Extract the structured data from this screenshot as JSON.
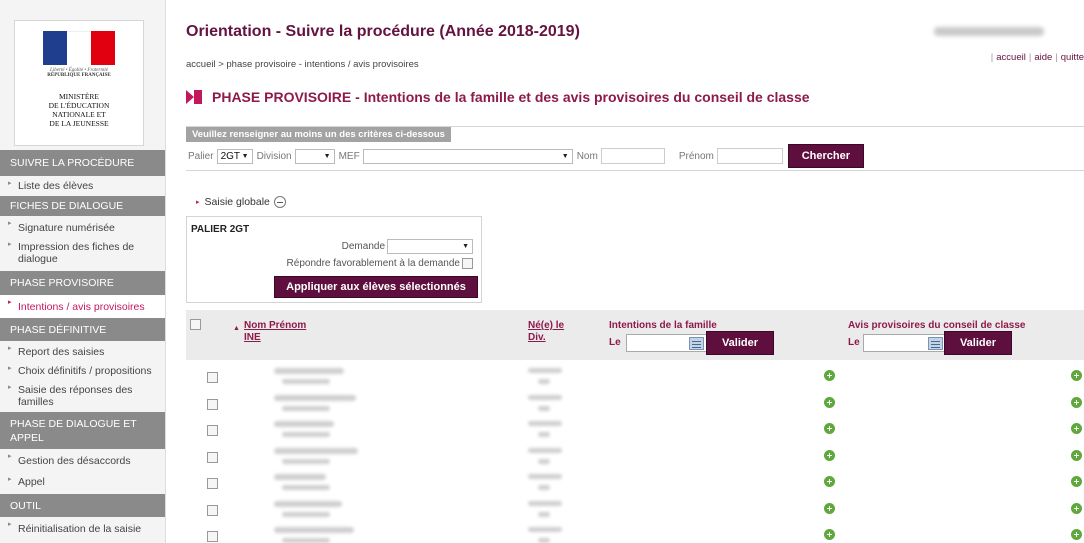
{
  "logo": {
    "motto": "Liberté • Égalité • Fraternité",
    "republique": "RÉPUBLIQUE FRANÇAISE",
    "ministry": "MINISTÈRE\nDE L'ÉDUCATION\nNATIONALE ET\nDE LA JEUNESSE"
  },
  "sidebar": {
    "sections": [
      {
        "title": "SUIVRE LA PROCÉDURE",
        "items": [
          "Liste des élèves"
        ]
      },
      {
        "title": "FICHES DE DIALOGUE",
        "items": [
          "Signature numérisée",
          "Impression des fiches de dialogue"
        ]
      },
      {
        "title": "PHASE PROVISOIRE",
        "items": [
          "Intentions / avis provisoires"
        ]
      },
      {
        "title": "PHASE DÉFINITIVE",
        "items": [
          "Report des saisies",
          "Choix définitifs / propositions",
          "Saisie des réponses des familles"
        ]
      },
      {
        "title": "PHASE DE DIALOGUE ET APPEL",
        "items": [
          "Gestion des désaccords",
          "Appel"
        ]
      },
      {
        "title": "OUTIL",
        "items": [
          "Réinitialisation de la saisie"
        ]
      }
    ],
    "active_item": "Intentions / avis provisoires"
  },
  "header": {
    "title": "Orientation - Suivre la procédure (Année 2018-2019)",
    "breadcrumb": "accueil > phase provisoire - intentions / avis provisoires",
    "links": [
      "accueil",
      "aide",
      "quitte"
    ]
  },
  "phase_title": "PHASE PROVISOIRE - Intentions de la famille et des avis provisoires du conseil de classe",
  "criteria": {
    "legend": "Veuillez renseigner au moins un des critères ci-dessous",
    "palier_label": "Palier",
    "palier_value": "2GT",
    "division_label": "Division",
    "division_value": "",
    "mef_label": "MEF",
    "mef_value": "",
    "nom_label": "Nom",
    "prenom_label": "Prénom",
    "search_button": "Chercher"
  },
  "saisie_globale": {
    "label": "Saisie globale",
    "palier_title": "PALIER 2GT",
    "demande_label": "Demande",
    "demande_value": "",
    "repondre_label": "Répondre favorablement à la demande",
    "apply_button": "Appliquer aux élèves sélectionnés"
  },
  "table": {
    "col_name": "Nom Prénom",
    "col_ine": "INE",
    "col_birth": "Né(e) le",
    "col_div": "Div.",
    "col_intentions": "Intentions de la famille",
    "col_avis": "Avis provisoires du conseil de classe",
    "le_label": "Le",
    "valider_label": "Valider",
    "rows": [
      {
        "checked": false,
        "action_intentions": "add",
        "action_avis": "add"
      },
      {
        "checked": false,
        "action_intentions": "add",
        "action_avis": "add"
      },
      {
        "checked": false,
        "action_intentions": "add",
        "action_avis": "add"
      },
      {
        "checked": false,
        "action_intentions": "add",
        "action_avis": "add"
      },
      {
        "checked": false,
        "action_intentions": "add",
        "action_avis": "add"
      },
      {
        "checked": false,
        "action_intentions": "add",
        "action_avis": "add"
      },
      {
        "checked": false,
        "action_intentions": "add",
        "action_avis": "add"
      }
    ]
  },
  "colors": {
    "accent": "#64123f",
    "phase": "#8e1a4a",
    "active": "#c2185b",
    "section_bg": "#8a8a8a",
    "add_icon": "#5fa83c"
  }
}
